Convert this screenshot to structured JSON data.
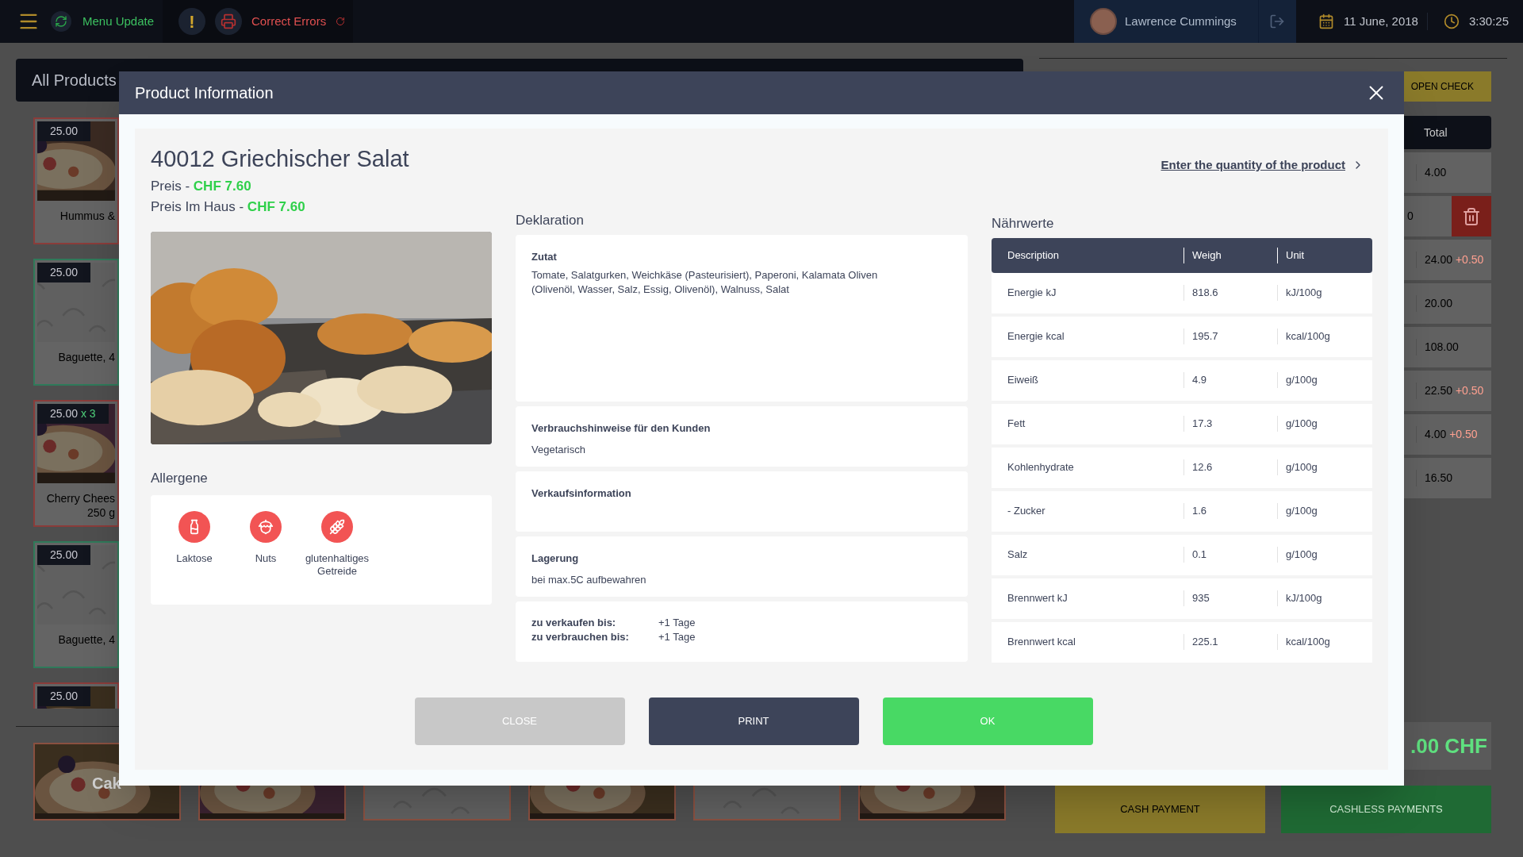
{
  "top_bar": {
    "menu_update": "Menu Update",
    "alert": "!",
    "correct_errors": "Correct Errors",
    "user": "Lawrence Cummings",
    "date": "11 June, 2018",
    "time": "3:30:25"
  },
  "products_panel": {
    "title": "All Products",
    "products": [
      {
        "price": "25.00",
        "name": "Hummus &",
        "kind": "picture",
        "color": "#8a3c3a"
      },
      {
        "price": "25.00",
        "name": "Baguette, 4",
        "kind": "pattern",
        "color": "#2f7a5a"
      },
      {
        "price": "25.00",
        "quantity": "x 3",
        "name": "Cherry Chees",
        "name_line_2": "250 g",
        "kind": "picture",
        "color": "#8a3c3a"
      },
      {
        "price": "25.00",
        "name": "Baguette, 4",
        "kind": "pattern",
        "color": "#2f7a5a"
      },
      {
        "price": "25.00",
        "kind": "picture",
        "color": "#8a3c3a"
      }
    ],
    "categories": [
      {
        "label": "Cak",
        "kind": "picture"
      },
      {
        "kind": "picture"
      },
      {
        "kind": "pattern"
      },
      {
        "kind": "picture"
      },
      {
        "kind": "pattern"
      },
      {
        "kind": "picture"
      }
    ]
  },
  "order_panel": {
    "open_check": "OPEN CHECK",
    "column": "Total",
    "rows": [
      {
        "total": "4.00",
        "delete": false
      },
      {
        "total": "0",
        "delete": true
      },
      {
        "total": "24.00",
        "extra": "+0.50",
        "delete": false
      },
      {
        "total": "20.00",
        "delete": false
      },
      {
        "total": "108.00",
        "delete": false
      },
      {
        "total": "22.50",
        "extra": "+0.50",
        "delete": false
      },
      {
        "total": "4.00",
        "extra": "+0.50",
        "delete": false
      },
      {
        "total": "16.50",
        "delete": false
      }
    ],
    "sum": ".00 CHF",
    "cash": "CASH PAYMENT",
    "cashless": "CASHLESS PAYMENTS"
  },
  "modal": {
    "title": "Product Information",
    "product": "40012 Griechischer Salat",
    "prices": [
      {
        "label": "Preis - ",
        "value": "CHF 7.60"
      },
      {
        "label": "Preis Im Haus - ",
        "value": "CHF 7.60"
      }
    ],
    "quantity_link": "Enter the quantity of the product",
    "allergens_title": "Allergene",
    "allergens": [
      {
        "kind": "milk",
        "label": "Laktose"
      },
      {
        "kind": "nut",
        "label": "Nuts"
      },
      {
        "kind": "wheat",
        "label": "glutenhaltiges Getreide"
      }
    ],
    "declaration_title": "Deklaration",
    "declaration": [
      {
        "title": "Zutat",
        "text": "Tomate, Salatgurken, Weichkäse (Pasteurisiert), Paperoni, Kalamata Oliven (Olivenöl, Wasser, Salz, Essig, Olivenöl), Walnuss, Salat",
        "kind": "ingredients"
      },
      {
        "title": "Verbrauchshinweise für den Kunden",
        "text": "Vegetarisch",
        "kind": "info"
      },
      {
        "title": "Verkaufsinformation",
        "kind": "info"
      },
      {
        "title": "Lagerung",
        "text": "bei max.5C aufbewahren",
        "kind": "info"
      }
    ],
    "dates": [
      {
        "label": "zu verkaufen bis:",
        "value": "+1 Tage"
      },
      {
        "label": "zu verbrauchen bis:",
        "value": "+1 Tage"
      }
    ],
    "nutrition_title": "Nährwerte",
    "nutrition_columns": [
      "Description",
      "Weigh",
      "Unit"
    ],
    "nutrition_rows": [
      [
        "Energie kJ",
        "818.6",
        "kJ/100g"
      ],
      [
        "Energie kcal",
        "195.7",
        "kcal/100g"
      ],
      [
        "Eiweiß",
        "4.9",
        "g/100g"
      ],
      [
        "Fett",
        "17.3",
        "g/100g"
      ],
      [
        "Kohlenhydrate",
        "12.6",
        "g/100g"
      ],
      [
        "- Zucker",
        "1.6",
        "g/100g"
      ],
      [
        "Salz",
        "0.1",
        "g/100g"
      ],
      [
        "Brennwert kJ",
        "935",
        "kJ/100g"
      ],
      [
        "Brennwert kcal",
        "225.1",
        "kcal/100g"
      ]
    ],
    "buttons": [
      {
        "label": "CLOSE",
        "kind": "disabled"
      },
      {
        "label": "PRINT",
        "kind": "dark"
      },
      {
        "label": "OK",
        "kind": "confirm"
      }
    ]
  }
}
